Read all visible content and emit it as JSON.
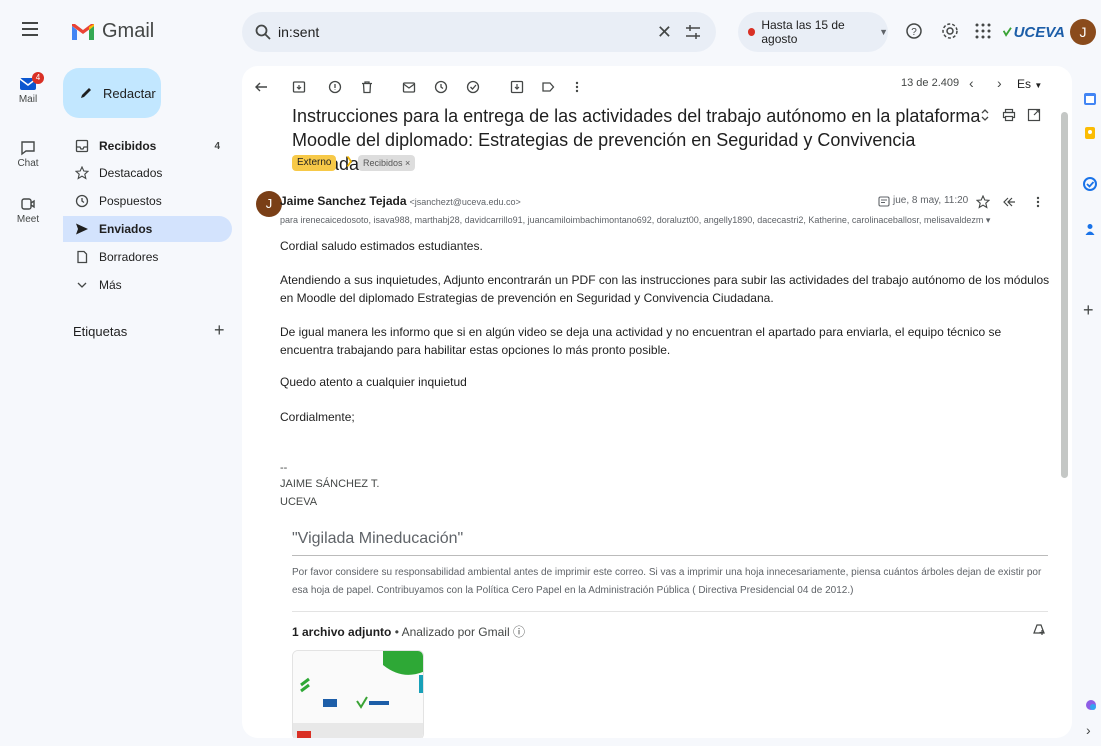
{
  "app": {
    "name": "Gmail"
  },
  "search": {
    "query": "in:sent"
  },
  "status": {
    "label": "Hasta las 15 de agosto"
  },
  "org": {
    "name": "UCEVA"
  },
  "user": {
    "initial": "J"
  },
  "rail": {
    "mail_label": "Mail",
    "mail_badge": "4",
    "chat_label": "Chat",
    "meet_label": "Meet"
  },
  "nav": {
    "compose": "Redactar",
    "items": [
      {
        "label": "Recibidos",
        "count": "4"
      },
      {
        "label": "Destacados"
      },
      {
        "label": "Pospuestos"
      },
      {
        "label": "Enviados"
      },
      {
        "label": "Borradores"
      },
      {
        "label": "Más"
      }
    ],
    "labels_heading": "Etiquetas"
  },
  "toolbar": {
    "pager": "13 de 2.409",
    "language": "Es"
  },
  "email": {
    "subject": "Instrucciones para la entrega de las actividades del trabajo autónomo en la plataforma Moodle del diplomado: Estrategias de prevención en Seguridad y Convivencia Ciudadana",
    "chip_external": "Externo",
    "chip_label": "Recibidos ×",
    "sender_name": "Jaime Sanchez Tejada",
    "sender_email": "<jsanchezt@uceva.edu.co>",
    "recipients": "para irenecaicedosoto, isava988, marthabj28, davidcarrillo91, juancamiloimbachimontano692, doraluzt00, angelly1890, dacecastri2, Katherine, carolinaceballosr, melisavaldezm ▾",
    "date": "jue, 8 may, 11:20",
    "greeting": "Cordial saludo estimados estudiantes.",
    "para1": "Atendiendo a sus inquietudes, Adjunto encontrarán un PDF con las instrucciones para subir las actividades del trabajo autónomo de los módulos en Moodle del diplomado Estrategias de prevención en Seguridad y Convivencia Ciudadana.",
    "para2": "De igual manera les informo que si en algún video se deja una actividad y no encuentran el apartado para enviarla, el equipo técnico se encuentra trabajando para habilitar estas opciones lo más pronto posible.",
    "para3": "Quedo atento a cualquier inquietud",
    "closing": "Cordialmente;",
    "sig_dash": "--",
    "sig_name": "JAIME SÁNCHEZ T.",
    "sig_org": "UCEVA",
    "vigilada": "\"Vigilada Mineducación\"",
    "disclaimer": "Por favor considere su responsabilidad ambiental antes de imprimir este correo.  Si vas a imprimir una hoja innecesariamente, piensa cuántos árboles dejan de existir por esa hoja de papel.   Contribuyamos con la Política Cero Papel en la Administración Pública ( Directiva Presidencial 04 de 2012.)",
    "attach_count": "1 archivo adjunto",
    "attach_scan": "• Analizado por Gmail ⓘ"
  },
  "colors": {
    "accent": "#c2e7ff",
    "active_nav": "#d3e3fd",
    "external_chip": "#f7c948"
  }
}
